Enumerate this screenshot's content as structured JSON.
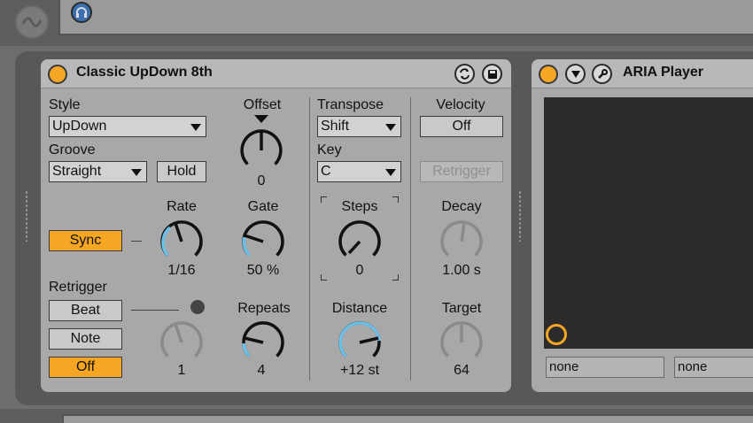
{
  "device": {
    "title": "Classic UpDown 8th",
    "style": {
      "label": "Style",
      "value": "UpDown"
    },
    "groove": {
      "label": "Groove",
      "value": "Straight"
    },
    "hold_label": "Hold",
    "offset": {
      "label": "Offset",
      "value": "0"
    },
    "sync_label": "Sync",
    "rate": {
      "label": "Rate",
      "value": "1/16"
    },
    "gate": {
      "label": "Gate",
      "value": "50 %"
    },
    "retrigger": {
      "label": "Retrigger",
      "options": [
        "Beat",
        "Note",
        "Off"
      ],
      "selected": "Off"
    },
    "repeats": {
      "label": "Repeats",
      "value": "4"
    },
    "retrigger_knob_value": "1",
    "transpose": {
      "label": "Transpose",
      "value": "Shift"
    },
    "key": {
      "label": "Key",
      "value": "C"
    },
    "steps": {
      "label": "Steps",
      "value": "0"
    },
    "distance": {
      "label": "Distance",
      "value": "+12 st"
    },
    "velocity": {
      "label": "Velocity",
      "toggle": "Off"
    },
    "retrigger_btn_label": "Retrigger",
    "decay": {
      "label": "Decay",
      "value": "1.00 s"
    },
    "target": {
      "label": "Target",
      "value": "64"
    }
  },
  "aria": {
    "title": "ARIA Player",
    "fields": [
      "none",
      "none"
    ]
  },
  "colors": {
    "accent": "#f5a623",
    "knob_arc": "#6cc0e8",
    "panel": "#a8a8a8"
  },
  "icons": [
    "headphone-icon",
    "hot-swap-icon",
    "save-icon",
    "fold-icon",
    "wrench-icon",
    "wave-icon"
  ]
}
